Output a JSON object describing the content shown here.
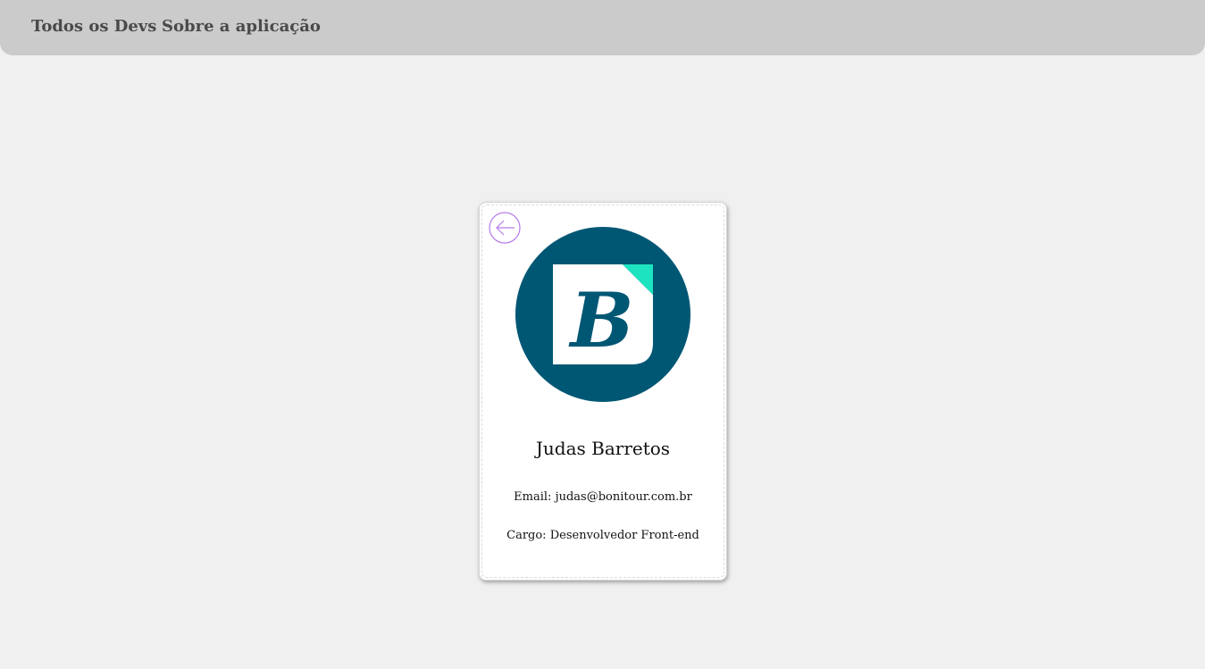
{
  "nav": {
    "all_devs": "Todos os Devs",
    "about": "Sobre a aplicação"
  },
  "profile": {
    "name": "Judas Barretos",
    "email_label": "Email:",
    "email": "judas@bonitour.com.br",
    "role_label": "Cargo:",
    "role": "Desenvolvedor Front-end",
    "avatar_letter": "B",
    "avatar_icon": "bonitour-logo-icon",
    "back_icon": "arrow-left-circle-icon"
  },
  "colors": {
    "background": "#f0f0f0",
    "topbar": "#cbcbcb",
    "nav_text": "#4a4a4a",
    "avatar_bg": "#005774",
    "avatar_accent": "#1ee3c0",
    "back_icon": "#b57be8"
  }
}
